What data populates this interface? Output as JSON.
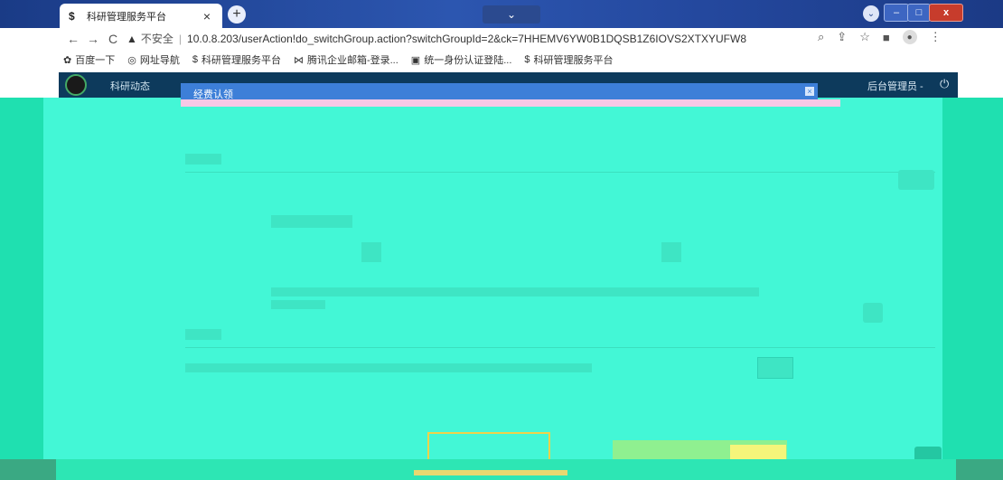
{
  "browser": {
    "tab_title": "科研管理服务平台",
    "tab_close": "×",
    "new_tab": "+",
    "tab_search": "⌄",
    "url_insecure_label": "不安全",
    "url": "10.0.8.203/userAction!do_switchGroup.action?switchGroupId=2&ck=7HHEMV6YW0B1DQSB1Z6IOVS2XTXYUFW8",
    "bookmarks": [
      {
        "icon": "✿",
        "label": "百度一下"
      },
      {
        "icon": "◎",
        "label": "网址导航"
      },
      {
        "icon": "$",
        "label": "科研管理服务平台"
      },
      {
        "icon": "⋈",
        "label": "腾讯企业邮箱-登录..."
      },
      {
        "icon": "▣",
        "label": "统一身份认证登陆..."
      },
      {
        "icon": "$",
        "label": "科研管理服务平台"
      }
    ]
  },
  "app": {
    "nav_first_item": "科研动态",
    "admin_label": "后台管理员 -",
    "dialog_title": "经费认领",
    "dialog_close": "×"
  },
  "colors": {
    "overlay": "#36f0c8",
    "appbar": "#0d3a5c",
    "dialog_header": "#3d7fd8"
  }
}
